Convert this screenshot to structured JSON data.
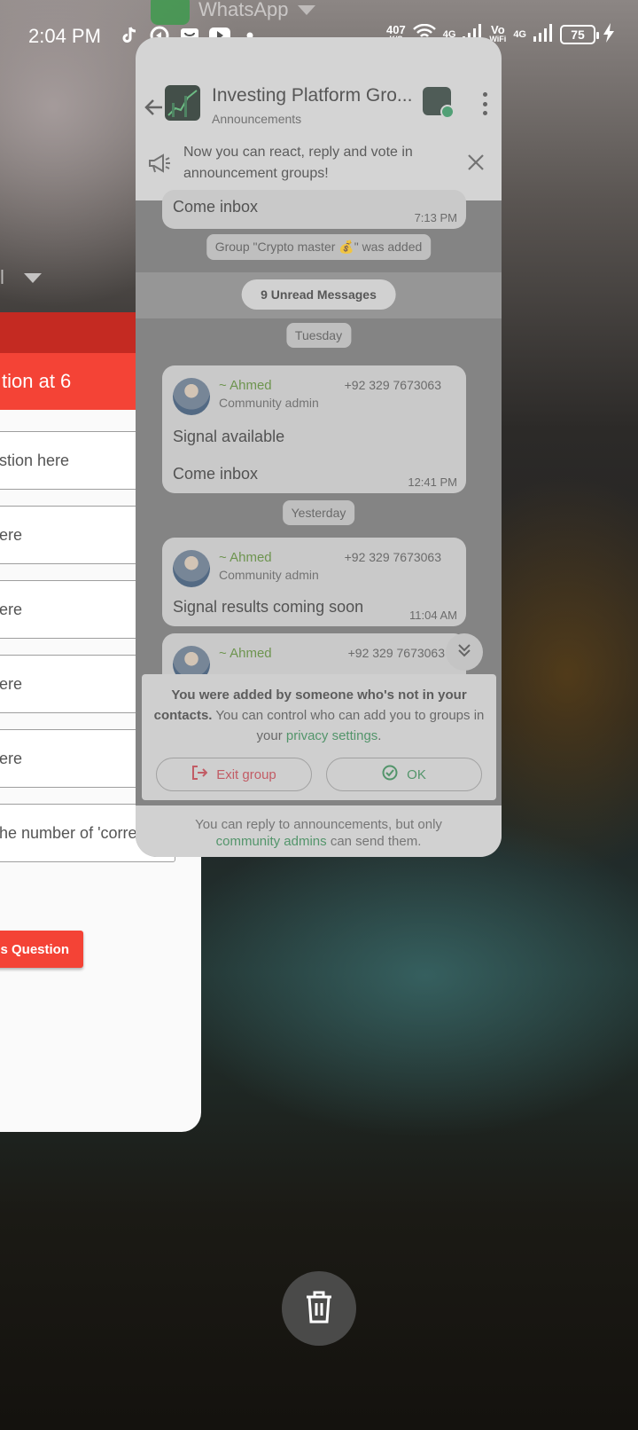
{
  "status_bar": {
    "time": "2:04 PM",
    "net_speed_value": "407",
    "net_speed_unit": "K/S",
    "sim1_label": "4G",
    "volte_label_top": "Vo",
    "volte_label_bottom": "WiFi",
    "sim2_label": "4G",
    "battery": "75"
  },
  "recents": {
    "app_label": "WhatsApp"
  },
  "left_card": {
    "header_stub": "l",
    "title": "tion at 6",
    "fields": [
      "stion here",
      "ere",
      "ere",
      "ere",
      "ere",
      "he number of 'correct' ..."
    ],
    "button_label": "his Question"
  },
  "chat": {
    "group_title": "Investing Platform Gro...",
    "group_subtitle": "Announcements",
    "notice_text": "Now you can react, reply and vote in announcement groups!",
    "messages": {
      "first_partial_text": "Come inbox",
      "first_partial_time": "7:13 PM",
      "system_added": "Group \"Crypto master 💰\" was added",
      "unread_label": "9 Unread Messages",
      "day1": "Tuesday",
      "msg1_sender": "~ Ahmed",
      "msg1_role": "Community admin",
      "msg1_phone": "+92 329 7673063",
      "msg1_line1": "Signal available",
      "msg1_line2": "Come inbox",
      "msg1_time": "12:41 PM",
      "day2": "Yesterday",
      "msg2_sender": "~ Ahmed",
      "msg2_role": "Community admin",
      "msg2_phone": "+92 329 7673063",
      "msg2_text": "Signal results coming soon",
      "msg2_time": "11:04 AM",
      "msg3_sender": "~ Ahmed",
      "msg3_phone": "+92 329 7673063"
    },
    "added_panel": {
      "bold_text": "You were added by someone who's not in your contacts.",
      "text": "You can control who can add you to groups in your",
      "link": "privacy settings",
      "period": ".",
      "exit_label": "Exit group",
      "ok_label": "OK"
    },
    "footer": {
      "text_before": "You can reply to announcements, but only",
      "link": "community admins",
      "text_after": "can send them."
    }
  },
  "colors": {
    "accent_green": "#3f8f5c",
    "form_red": "#f44336",
    "exit_red": "#c64a55"
  }
}
